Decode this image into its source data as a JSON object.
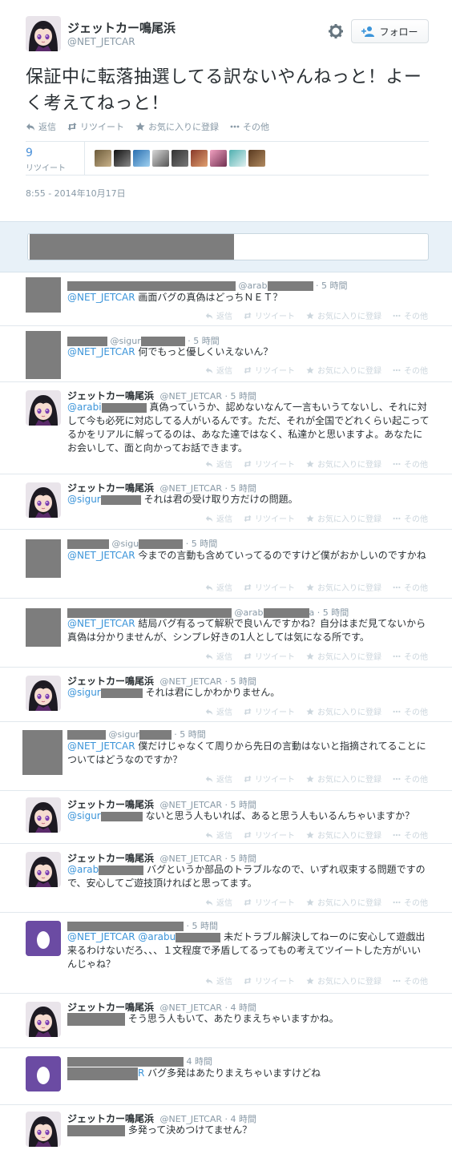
{
  "main_tweet": {
    "name": "ジェットカー鳴尾浜",
    "handle": "@NET_JETCAR",
    "follow_label": "フォロー",
    "text": "保証中に転落抽選してる訳ないやんねっと！よーく考えてねっと！",
    "actions": {
      "reply": "返信",
      "retweet": "リツイート",
      "favorite": "お気に入りに登録",
      "more": "その他"
    },
    "retweet_count": "9",
    "retweet_label": "リツイート",
    "timestamp": "8:55 - 2014年10月17日"
  },
  "reply_actions": {
    "reply": "返信",
    "retweet": "リツイート",
    "favorite": "お気に入りに登録",
    "more": "その他"
  },
  "replies": [
    {
      "handle": "@arab",
      "time": "· 5 時間",
      "mention": "@NET_JETCAR",
      "text": " 画面バグの真偽はどっちＮＥＴ？"
    },
    {
      "handle": "@sigur",
      "time": "· 5 時間",
      "mention": "@NET_JETCAR",
      "text": " 何でもっと優しくいえないん？"
    },
    {
      "name": "ジェットカー鳴尾浜",
      "handle": "@NET_JETCAR",
      "time": "· 5 時間",
      "mention": "@arabi",
      "text": " 真偽っていうか、認めないなんて一言もいうてないし、それに対して今も必死に対応してる人がいるんです。ただ、それが全国でどれくらい起こってるかをリアルに解ってるのは、あなた達ではなく、私達かと思いますよ。あなたにお会いして、面と向かってお話できます。"
    },
    {
      "name": "ジェットカー鳴尾浜",
      "handle": "@NET_JETCAR",
      "time": "· 5 時間",
      "mention": "@sigur",
      "text": " それは君の受け取り方だけの問題。"
    },
    {
      "handle": "@sigu",
      "time": "· 5 時間",
      "mention": "@NET_JETCAR",
      "text": " 今までの言動も含めていってるのですけど僕がおかしいのですかね"
    },
    {
      "handle": "@arab",
      "handle_tail": "a",
      "time": "· 5 時間",
      "mention": "@NET_JETCAR",
      "text": " 結局バグ有るって解釈で良いんですかね？自分はまだ見てないから真偽は分かりませんが、シンプレ好きの1人としては気になる所です。"
    },
    {
      "name": "ジェットカー鳴尾浜",
      "handle": "@NET_JETCAR",
      "time": "· 5 時間",
      "mention": "@sigur",
      "text": " それは君にしかわかりません。"
    },
    {
      "handle": "@sigur",
      "time": "· 5 時間",
      "mention": "@NET_JETCAR",
      "text": " 僕だけじゃなくて周りから先日の言動はないと指摘されてることについてはどうなのですか？"
    },
    {
      "name": "ジェットカー鳴尾浜",
      "handle": "@NET_JETCAR",
      "time": "· 5 時間",
      "mention": "@sigur",
      "text": " ないと思う人もいれば、あると思う人もいるんちゃいますか？"
    },
    {
      "name": "ジェットカー鳴尾浜",
      "handle": "@NET_JETCAR",
      "time": "· 5 時間",
      "mention": "@arab",
      "text": " バグというか部品のトラブルなので、いずれ収束する問題ですので、安心してご遊技頂ければと思ってます。"
    },
    {
      "time": "· 5 時間",
      "mention": "@NET_JETCAR @arabu",
      "text": " 未だトラブル解決してねーのに安心して遊戯出来るわけないだろ、、、１文程度で矛盾してるってもの考えてツイートした方がいいんじゃね？"
    },
    {
      "name": "ジェットカー鳴尾浜",
      "handle": "@NET_JETCAR",
      "time": "· 4 時間",
      "text": " そう思う人もいて、あたりまえちゃいますかね。"
    },
    {
      "time": "4 時間",
      "mention_tail": "R",
      "text": " バグ多発はあたりまえちゃいますけどね"
    },
    {
      "name": "ジェットカー鳴尾浜",
      "handle": "@NET_JETCAR",
      "time": "· 4 時間",
      "text": " 多発って決めつけてません？"
    }
  ],
  "colors": {
    "mention": "#3b94d9",
    "muted": "#8899a6",
    "redaction": "#7d7d7d",
    "reply_bar": "#e8f1f8",
    "egg_avatar": "#6b4ba3"
  }
}
